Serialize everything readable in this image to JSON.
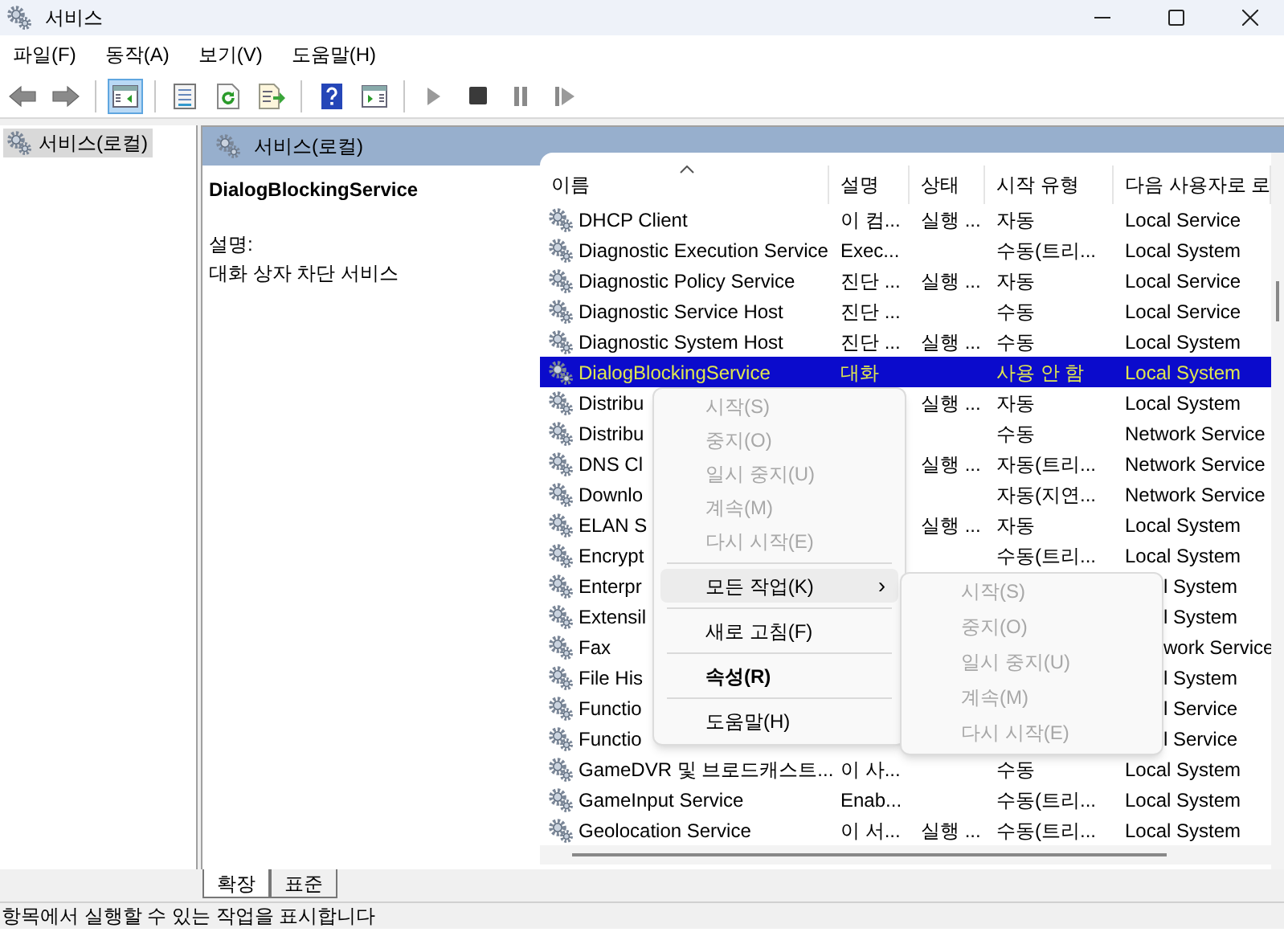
{
  "window": {
    "title": "서비스"
  },
  "menu_bar": [
    "파일(F)",
    "동작(A)",
    "보기(V)",
    "도움말(H)"
  ],
  "toolbar": [
    {
      "kind": "back",
      "selected": false
    },
    {
      "kind": "forward",
      "selected": false
    },
    {
      "kind": "separator"
    },
    {
      "kind": "tree",
      "selected": true
    },
    {
      "kind": "separator"
    },
    {
      "kind": "properties",
      "selected": false
    },
    {
      "kind": "refresh",
      "selected": false
    },
    {
      "kind": "export",
      "selected": false
    },
    {
      "kind": "separator"
    },
    {
      "kind": "help",
      "selected": false
    },
    {
      "kind": "action_pane",
      "selected": false
    },
    {
      "kind": "separator"
    },
    {
      "kind": "start",
      "selected": false
    },
    {
      "kind": "stop",
      "selected": false
    },
    {
      "kind": "pause",
      "selected": false
    },
    {
      "kind": "resume",
      "selected": false
    }
  ],
  "tree": {
    "items": [
      {
        "label": "서비스(로컬)",
        "selected": true
      }
    ]
  },
  "pane_header": "서비스(로컬)",
  "details": {
    "service_name": "DialogBlockingService",
    "description_label": "설명:",
    "description": "대화 상자 차단 서비스"
  },
  "table": {
    "columns": [
      "이름",
      "설명",
      "상태",
      "시작 유형",
      "다음 사용자로 로"
    ],
    "rows": [
      {
        "name": "DHCP Client",
        "description": "이 컴...",
        "status": "실행 ...",
        "startup": "자동",
        "logon": "Local Service",
        "selected": false
      },
      {
        "name": "Diagnostic Execution Service",
        "description": "Exec...",
        "startup": "수동(트리...",
        "logon": "Local System",
        "selected": false
      },
      {
        "name": "Diagnostic Policy Service",
        "description": "진단 ...",
        "status": "실행 ...",
        "startup": "자동",
        "logon": "Local Service",
        "selected": false
      },
      {
        "name": "Diagnostic Service Host",
        "description": "진단 ...",
        "startup": "수동",
        "logon": "Local Service",
        "selected": false
      },
      {
        "name": "Diagnostic System Host",
        "description": "진단 ...",
        "status": "실행 ...",
        "startup": "수동",
        "logon": "Local System",
        "selected": false
      },
      {
        "name": "DialogBlockingService",
        "description": "대화",
        "startup": "사용 안 함",
        "logon": "Local System",
        "selected": true
      },
      {
        "name": "Distribu",
        "status": "실행 ...",
        "startup": "자동",
        "logon": "Local System",
        "selected": false
      },
      {
        "name": "Distribu",
        "startup": "수동",
        "logon": "Network Service",
        "selected": false
      },
      {
        "name": "DNS Cl",
        "status": "실행 ...",
        "startup": "자동(트리...",
        "logon": "Network Service",
        "selected": false
      },
      {
        "name": "Downlo",
        "startup": "자동(지연...",
        "logon": "Network Service",
        "selected": false
      },
      {
        "name": "ELAN S",
        "status": "실행 ...",
        "startup": "자동",
        "logon": "Local System",
        "selected": false
      },
      {
        "name": "Encrypt",
        "startup": "수동(트리...",
        "logon": "Local System",
        "selected": false
      },
      {
        "name": "Enterpr",
        "logon": "l System",
        "selected": false,
        "covered": true
      },
      {
        "name": "Extensil",
        "logon": "l System",
        "selected": false,
        "covered": true
      },
      {
        "name": "Fax",
        "logon": "work Service",
        "selected": false,
        "covered": true
      },
      {
        "name": "File His",
        "logon": "l System",
        "selected": false,
        "covered": true
      },
      {
        "name": "Functio",
        "logon": "l Service",
        "selected": false,
        "covered": true
      },
      {
        "name": "Functio",
        "logon": "l Service",
        "selected": false,
        "covered": true
      },
      {
        "name": "GameDVR 및 브로드캐스트...",
        "description": "이 사...",
        "startup": "수동",
        "logon": "Local System",
        "selected": false
      },
      {
        "name": "GameInput Service",
        "description": "Enab...",
        "startup": "수동(트리...",
        "logon": "Local System",
        "selected": false
      },
      {
        "name": "Geolocation Service",
        "description": "이 서...",
        "status": "실행 ...",
        "startup": "수동(트리...",
        "logon": "Local System",
        "selected": false
      }
    ]
  },
  "context_menu": {
    "items": [
      {
        "kind": "item",
        "label": "시작(S)",
        "disabled": true,
        "highlighted": false
      },
      {
        "kind": "item",
        "label": "중지(O)",
        "disabled": true,
        "highlighted": false
      },
      {
        "kind": "item",
        "label": "일시 중지(U)",
        "disabled": true,
        "highlighted": false
      },
      {
        "kind": "item",
        "label": "계속(M)",
        "disabled": true,
        "highlighted": false
      },
      {
        "kind": "item",
        "label": "다시 시작(E)",
        "disabled": true,
        "highlighted": false
      },
      {
        "kind": "separator"
      },
      {
        "kind": "submenu",
        "label": "모든 작업(K)",
        "arrow": "›",
        "disabled": false,
        "highlighted": true
      },
      {
        "kind": "separator"
      },
      {
        "kind": "item",
        "label": "새로 고침(F)",
        "disabled": false,
        "highlighted": false
      },
      {
        "kind": "separator"
      },
      {
        "kind": "default",
        "label": "속성(R)",
        "disabled": false,
        "highlighted": false
      },
      {
        "kind": "separator"
      },
      {
        "kind": "item",
        "label": "도움말(H)",
        "disabled": false,
        "highlighted": false
      }
    ]
  },
  "submenu": {
    "items": [
      {
        "kind": "item",
        "label": "시작(S)",
        "disabled": true
      },
      {
        "kind": "item",
        "label": "중지(O)",
        "disabled": true
      },
      {
        "kind": "item",
        "label": "일시 중지(U)",
        "disabled": true
      },
      {
        "kind": "item",
        "label": "계속(M)",
        "disabled": true
      },
      {
        "kind": "item",
        "label": "다시 시작(E)",
        "disabled": true
      }
    ]
  },
  "view_tabs": [
    {
      "label": "확장",
      "selected": true
    },
    {
      "label": "표준",
      "selected": false
    }
  ],
  "status_bar": "항목에서 실행할 수 있는 작업을 표시합니다"
}
